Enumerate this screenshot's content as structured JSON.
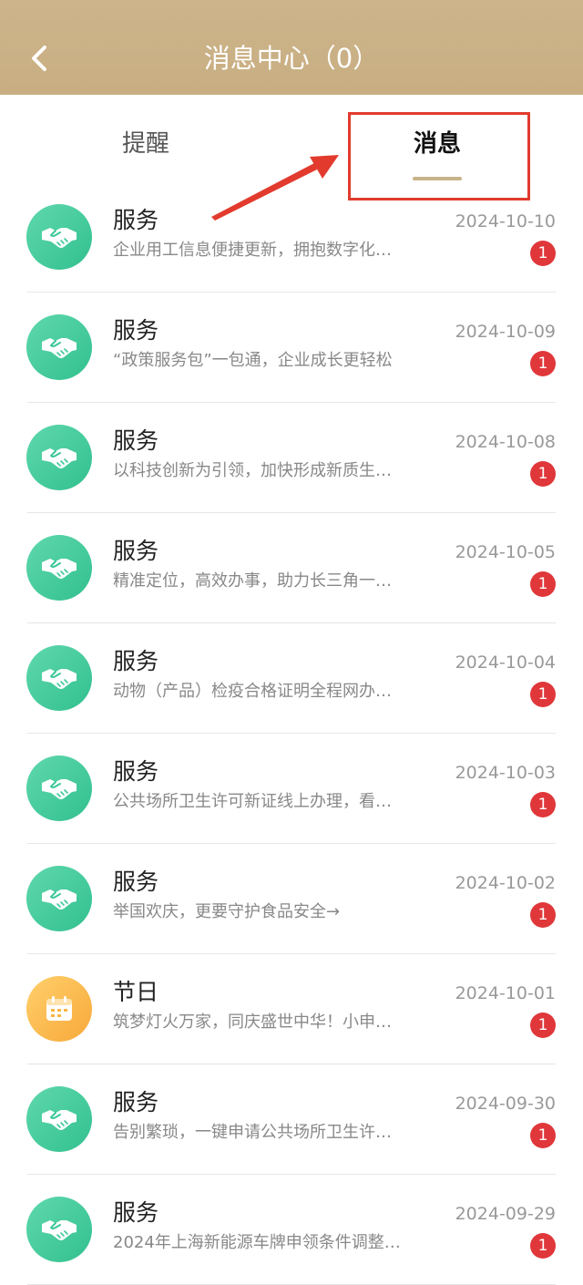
{
  "header": {
    "title": "消息中心（0）",
    "back_icon": "chevron-left-icon",
    "color": "#c8ae82"
  },
  "tabs": [
    {
      "label": "提醒",
      "active": false
    },
    {
      "label": "消息",
      "active": true
    }
  ],
  "annotation": {
    "color": "#e23b2e"
  },
  "messages": [
    {
      "category": "服务",
      "icon": "handshake-icon",
      "desc": "企业用工信息便捷更新，拥抱数字化…",
      "date": "2024-10-10",
      "badge": "1"
    },
    {
      "category": "服务",
      "icon": "handshake-icon",
      "desc": "“政策服务包”一包通，企业成长更轻松",
      "date": "2024-10-09",
      "badge": "1"
    },
    {
      "category": "服务",
      "icon": "handshake-icon",
      "desc": "以科技创新为引领，加快形成新质生…",
      "date": "2024-10-08",
      "badge": "1"
    },
    {
      "category": "服务",
      "icon": "handshake-icon",
      "desc": "精准定位，高效办事，助力长三角一…",
      "date": "2024-10-05",
      "badge": "1"
    },
    {
      "category": "服务",
      "icon": "handshake-icon",
      "desc": "动物（产品）检疫合格证明全程网办…",
      "date": "2024-10-04",
      "badge": "1"
    },
    {
      "category": "服务",
      "icon": "handshake-icon",
      "desc": "公共场所卫生许可新证线上办理，看…",
      "date": "2024-10-03",
      "badge": "1"
    },
    {
      "category": "服务",
      "icon": "handshake-icon",
      "desc": "举国欢庆，更要守护食品安全→",
      "date": "2024-10-02",
      "badge": "1"
    },
    {
      "category": "节日",
      "icon": "calendar-icon",
      "desc": "筑梦灯火万家，同庆盛世中华！小申…",
      "date": "2024-10-01",
      "badge": "1"
    },
    {
      "category": "服务",
      "icon": "handshake-icon",
      "desc": "告别繁琐，一键申请公共场所卫生许…",
      "date": "2024-09-30",
      "badge": "1"
    },
    {
      "category": "服务",
      "icon": "handshake-icon",
      "desc": "2024年上海新能源车牌申领条件调整…",
      "date": "2024-09-29",
      "badge": "1"
    }
  ]
}
